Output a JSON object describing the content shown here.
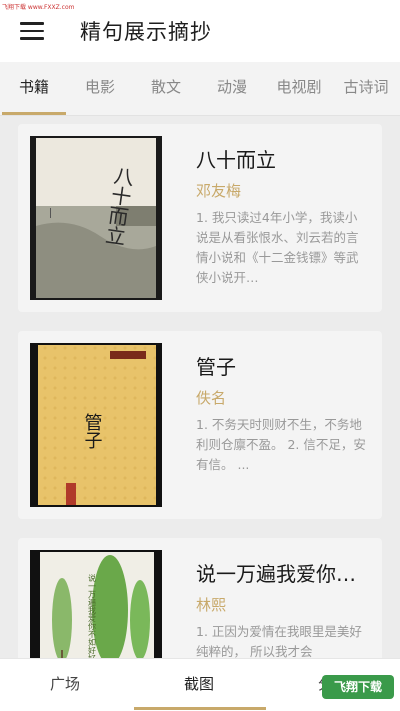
{
  "watermark_top": "飞翔下载 www.FXXZ.com",
  "appbar": {
    "title": "精句展示摘抄"
  },
  "tabs": [
    {
      "label": "书籍",
      "active": true
    },
    {
      "label": "电影",
      "active": false
    },
    {
      "label": "散文",
      "active": false
    },
    {
      "label": "动漫",
      "active": false
    },
    {
      "label": "电视剧",
      "active": false
    },
    {
      "label": "古诗词",
      "active": false
    }
  ],
  "books": [
    {
      "title": "八十而立",
      "author": "邓友梅",
      "excerpt": "1. 我只读过4年小学，我读小说是从看张恨水、刘云若的言情小说和《十二金钱镖》等武侠小说开…",
      "cover_text": "八十而立"
    },
    {
      "title": "管子",
      "author": "佚名",
      "excerpt": "1. 不务天时则财不生，不务地利则仓廪不盈。 2. 信不足，安有信。 ...",
      "cover_text": "管子"
    },
    {
      "title": "说一万遍我爱你…",
      "author": "林熙",
      "excerpt": "1. 正因为爱情在我眼里是美好纯粹的， 所以我才会",
      "cover_text": "说一万遍我爱你不如好好在"
    }
  ],
  "bottom_nav": [
    {
      "label": "广场",
      "active": false
    },
    {
      "label": "截图",
      "active": true
    },
    {
      "label": "分类",
      "active": false
    }
  ],
  "watermark_bottom": "飞翔下载",
  "colors": {
    "accent": "#c8a96a",
    "background": "#ececec",
    "card": "#f4f4f4"
  }
}
